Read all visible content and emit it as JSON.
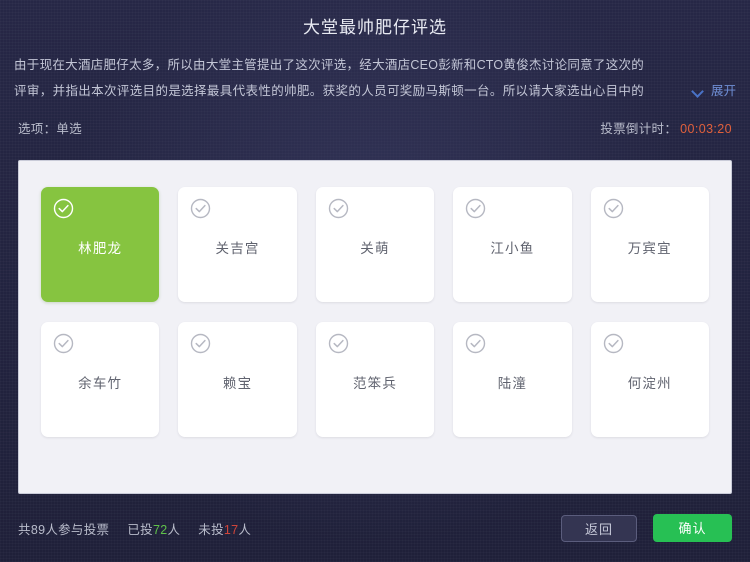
{
  "header": {
    "title": "大堂最帅肥仔评选",
    "description": "由于现在大酒店肥仔太多，所以由大堂主管提出了这次评选，经大酒店CEO彭新和CTO黄俊杰讨论同意了这次的评审，并指出本次评选目的是选择最具代表性的帅肥。获奖的人员可奖励马斯顿一台。所以请大家选出心目中的最佳的人选…",
    "expand_label": "展开",
    "expand_icon": "chevron-down-icon"
  },
  "meta": {
    "option_type_label": "选项：单选",
    "countdown_label": "投票倒计时：",
    "countdown_value": "00:03:20",
    "countdown_color": "#e0603c"
  },
  "options": {
    "selected_index": 0,
    "check_icon": "check-circle-icon",
    "selected_color": "#86c440",
    "items": [
      {
        "name": "林肥龙",
        "selected": true
      },
      {
        "name": "关吉宫",
        "selected": false
      },
      {
        "name": "关萌",
        "selected": false
      },
      {
        "name": "江小鱼",
        "selected": false
      },
      {
        "name": "万宾宜",
        "selected": false
      },
      {
        "name": "余车竹",
        "selected": false
      },
      {
        "name": "赖宝",
        "selected": false
      },
      {
        "name": "范笨兵",
        "selected": false
      },
      {
        "name": "陆潼",
        "selected": false
      },
      {
        "name": "何淀州",
        "selected": false
      }
    ]
  },
  "footer": {
    "total_prefix": "共",
    "total_count": "89",
    "total_suffix": "人参与投票",
    "voted_prefix": "已投",
    "voted_count": "72",
    "voted_suffix": "人",
    "voted_color": "#5fc14a",
    "not_voted_prefix": "未投",
    "not_voted_count": "17",
    "not_voted_suffix": "人",
    "not_voted_color": "#d0453a",
    "back_label": "返回",
    "confirm_label": "确认",
    "confirm_color": "#27c054"
  }
}
